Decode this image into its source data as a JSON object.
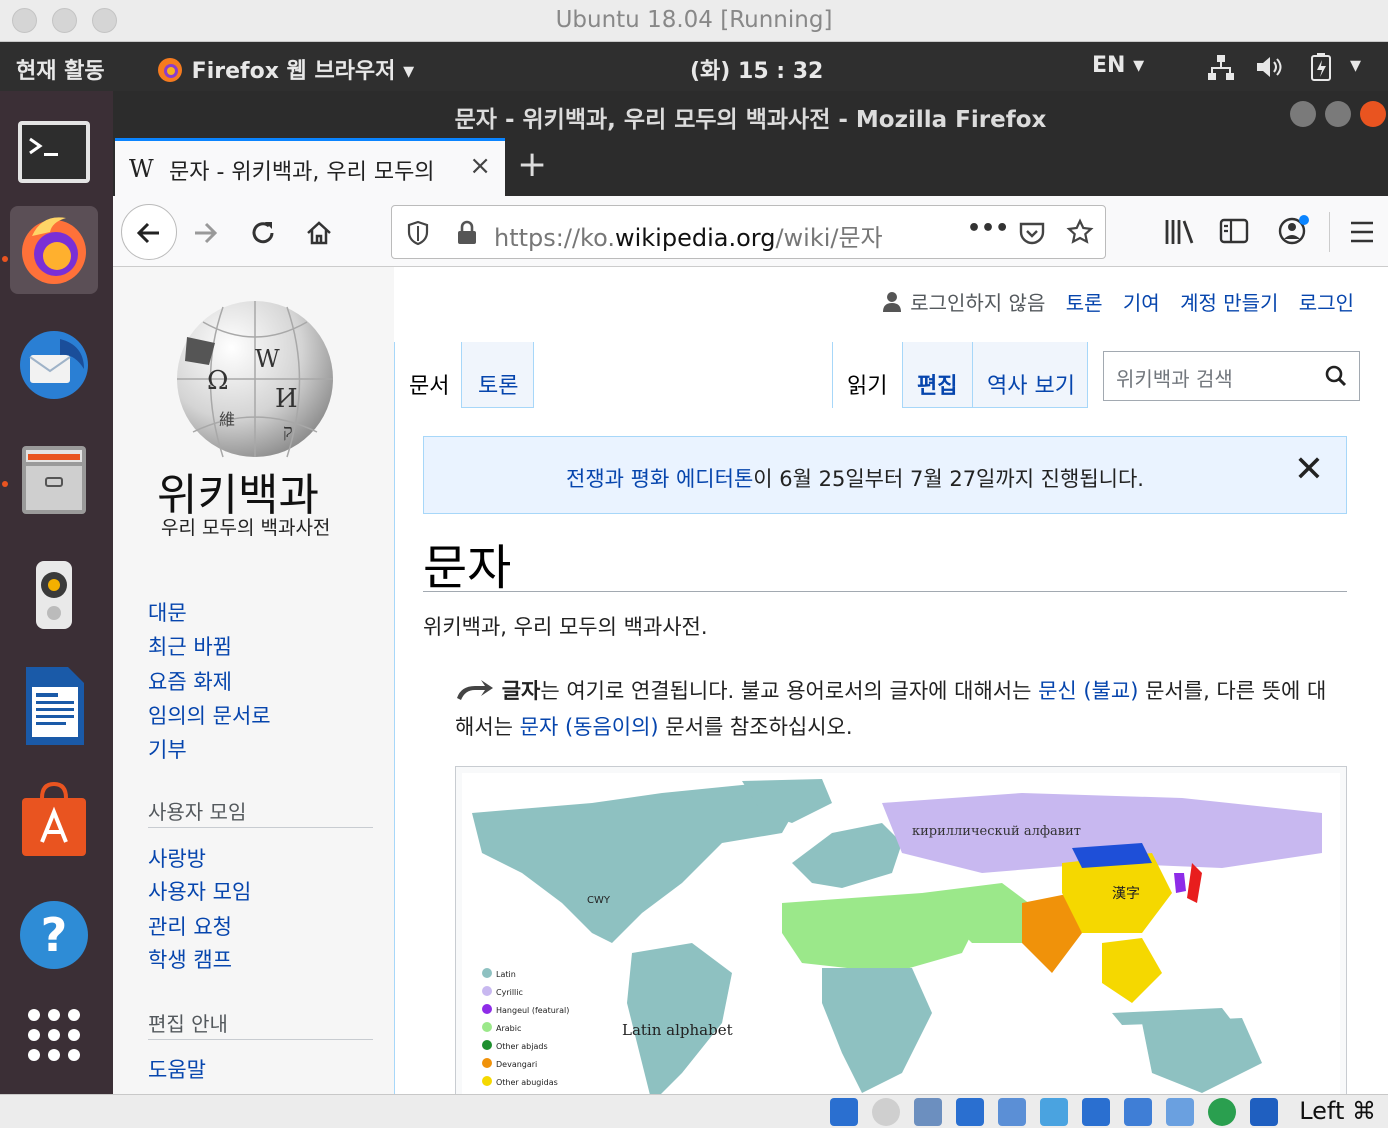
{
  "host_window": {
    "title": "Ubuntu 18.04 [Running]"
  },
  "top_panel": {
    "activities": "현재 활동",
    "app_menu": "Firefox 웹 브라우저",
    "app_menu_arrow": "▾",
    "clock": "(화) 15 : 32",
    "input_lang": "EN",
    "input_arrow": "▾",
    "system_arrow": "▾"
  },
  "dock": {
    "items": [
      "terminal-icon",
      "firefox-icon",
      "thunderbird-icon",
      "files-icon",
      "rhythmbox-icon",
      "libreoffice-writer-icon",
      "software-center-icon",
      "help-icon",
      "show-apps-icon"
    ]
  },
  "firefox": {
    "window_title": "문자 - 위키백과, 우리 모두의 백과사전 - Mozilla Firefox",
    "tab": {
      "favicon": "W",
      "label": "문자 - 위키백과, 우리 모두의",
      "close": "×"
    },
    "new_tab": "+",
    "url": {
      "prefix": "https://ko.",
      "domain": "wikipedia.org",
      "path": "/wiki/문자"
    },
    "url_more": "•••"
  },
  "wiki": {
    "logo_title": "위키백과",
    "logo_subtitle": "우리 모두의 백과사전",
    "personal": {
      "not_logged_in": "로그인하지 않음",
      "talk": "토론",
      "contrib": "기여",
      "create_account": "계정 만들기",
      "login": "로그인"
    },
    "tabs": {
      "article": "문서",
      "talk": "토론",
      "read": "읽기",
      "edit": "편집",
      "history": "역사 보기"
    },
    "search_placeholder": "위키백과 검색",
    "banner": {
      "link": "전쟁과 평화 에디터톤",
      "text": "이 6월 25일부터 7월 27일까지 진행됩니다.",
      "close": "✕"
    },
    "title": "문자",
    "tagline": "위키백과, 우리 모두의 백과사전.",
    "hatnote": {
      "bold": "글자",
      "t1": "는 여기로 연결됩니다. 불교 용어로서의 글자에 대해서는 ",
      "link1": "문신 (불교)",
      "t2": " 문서를, 다른 뜻에 대해서는 ",
      "link2": "문자 (동음이의)",
      "t3": " 문서를 참조하십시오."
    },
    "sidebar": {
      "nav": [
        "대문",
        "최근 바뀜",
        "요즘 화제",
        "임의의 문서로",
        "기부"
      ],
      "community_head": "사용자 모임",
      "community": [
        "사랑방",
        "사용자 모임",
        "관리 요청",
        "학생 캠프"
      ],
      "help_head": "편집 안내",
      "help": [
        "도움말"
      ]
    },
    "map": {
      "label_latin": "Latin alphabet",
      "label_cyrillic": "кириллическuй алфавит",
      "label_hanzi": "漢字",
      "label_cwy": "CWY",
      "legend": [
        {
          "label": "Latin",
          "color": "#8ec1c1"
        },
        {
          "label": "Cyrillic",
          "color": "#c8b8f0"
        },
        {
          "label": "Hangeul (featural)",
          "color": "#8e2ce8"
        },
        {
          "label": "Arabic",
          "color": "#9be88a"
        },
        {
          "label": "Other abjads",
          "color": "#1e8f2e"
        },
        {
          "label": "Devangari",
          "color": "#f0920a"
        },
        {
          "label": "Other abugidas",
          "color": "#f5d800"
        }
      ]
    }
  },
  "vbox": {
    "host_key": "Left ⌘"
  }
}
